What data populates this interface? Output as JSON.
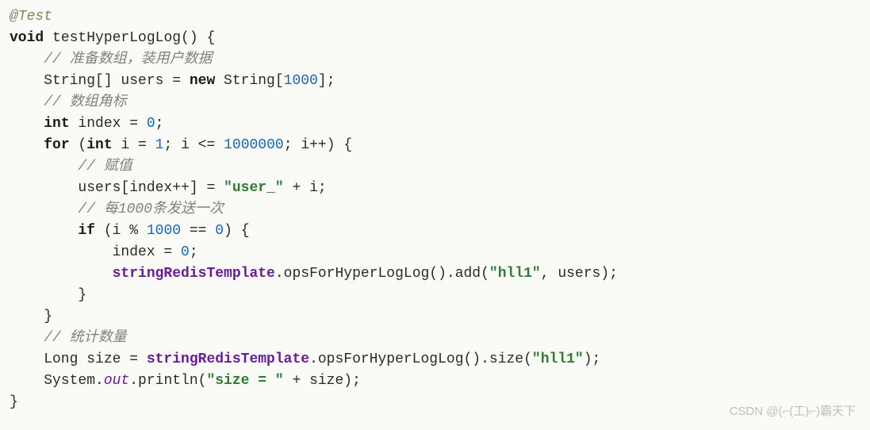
{
  "code": {
    "line1_annotation": "@Test",
    "line2_keyword_void": "void",
    "line2_method": " testHyperLogLog() {",
    "line3_comment": "// ",
    "line3_comment_cn": "准备数组，装用户数据",
    "line4_type": "    String[] users = ",
    "line4_keyword_new": "new",
    "line4_after_new": " String[",
    "line4_number": "1000",
    "line4_close": "];",
    "line5_comment": "// ",
    "line5_comment_cn": "数组角标",
    "line6_keyword_int": "int",
    "line6_text": " index = ",
    "line6_number": "0",
    "line6_semi": ";",
    "line7_keyword_for": "for",
    "line7_open": " (",
    "line7_keyword_int": "int",
    "line7_init": " i = ",
    "line7_num1": "1",
    "line7_cond": "; i <= ",
    "line7_num2": "1000000",
    "line7_inc": "; i++) {",
    "line8_comment": "// ",
    "line8_comment_cn": "赋值",
    "line9_text1": "        users[index++] = ",
    "line9_string": "\"user_\"",
    "line9_text2": " + i;",
    "line10_comment": "// ",
    "line10_comment_cn": "每1000条发送一次",
    "line11_keyword_if": "if",
    "line11_text1": " (i % ",
    "line11_num1": "1000",
    "line11_text2": " == ",
    "line11_num2": "0",
    "line11_text3": ") {",
    "line12_text1": "            index = ",
    "line12_num": "0",
    "line12_semi": ";",
    "line13_field": "stringRedisTemplate",
    "line13_text1": ".opsForHyperLogLog().add(",
    "line13_string": "\"hll1\"",
    "line13_text2": ", users);",
    "line14_close": "        }",
    "line15_close": "    }",
    "line16_comment": "// ",
    "line16_comment_cn": "统计数量",
    "line17_text1": "    Long size = ",
    "line17_field": "stringRedisTemplate",
    "line17_text2": ".opsForHyperLogLog().size(",
    "line17_string": "\"hll1\"",
    "line17_text3": ");",
    "line18_text1": "    System.",
    "line18_out": "out",
    "line18_text2": ".println(",
    "line18_string": "\"size = \"",
    "line18_text3": " + size);",
    "line19_close": "}"
  },
  "watermark": "CSDN @(⌐(工)⌐)霸天下"
}
